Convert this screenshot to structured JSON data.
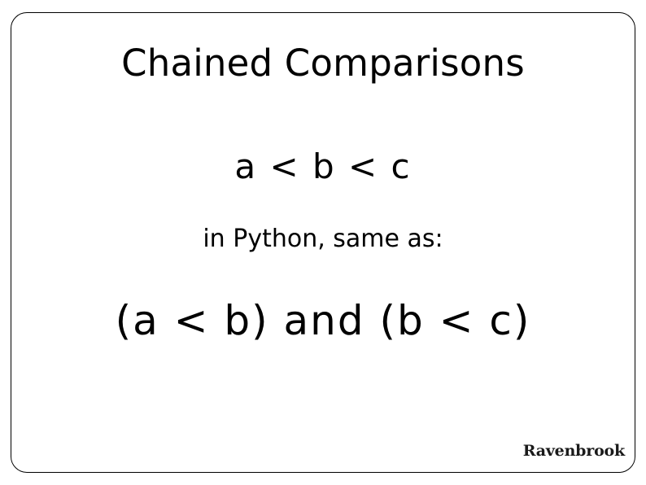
{
  "slide": {
    "title": "Chained Comparisons",
    "expression_primary": "a < b < c",
    "note": "in Python, same as:",
    "expression_secondary": "(a < b) and (b < c)",
    "brand": "Ravenbrook",
    "colors": {
      "background": "#ffffff",
      "text": "#000000",
      "border": "#000000",
      "brand_text": "#1a1a1a"
    }
  }
}
